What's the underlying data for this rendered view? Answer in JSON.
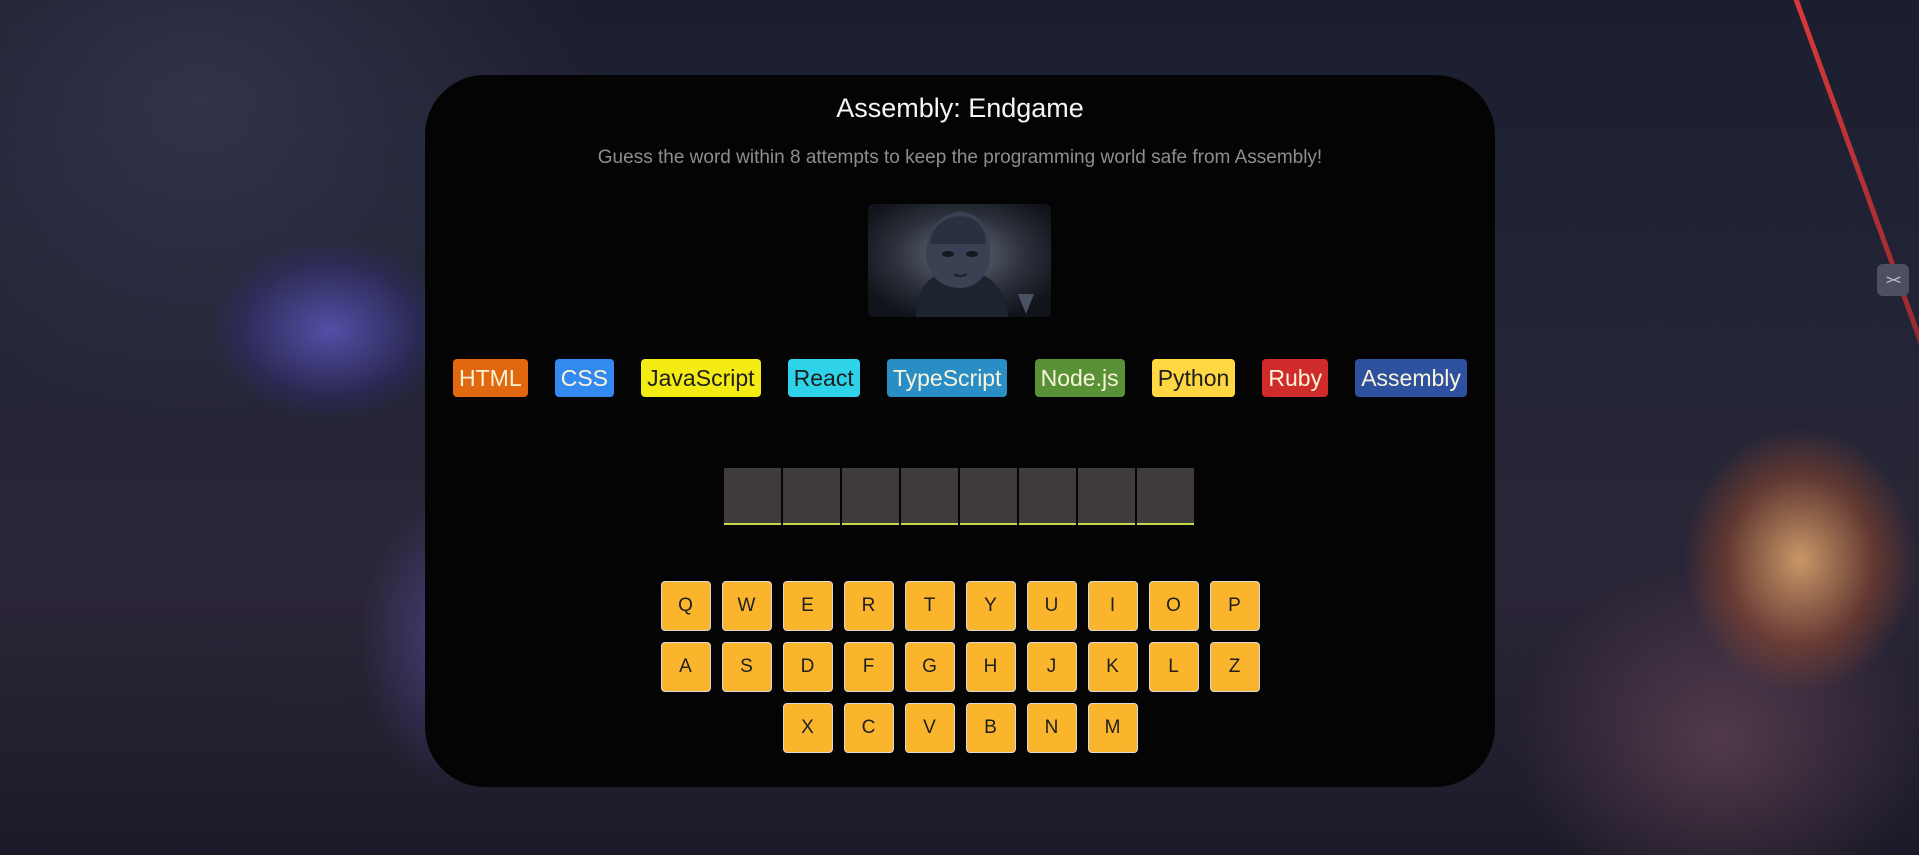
{
  "title": "Assembly: Endgame",
  "subtitle": "Guess the word within 8 attempts to keep the programming world safe from Assembly!",
  "side_button_icon": "collapse-arrows-icon",
  "side_button_glyph": "><",
  "languages": [
    {
      "name": "HTML",
      "bg": "#E2680F",
      "color": "#F9F4DA"
    },
    {
      "name": "CSS",
      "bg": "#328AF1",
      "color": "#F9F4DA"
    },
    {
      "name": "JavaScript",
      "bg": "#F4EB13",
      "color": "#1E1E1E"
    },
    {
      "name": "React",
      "bg": "#2ED3E9",
      "color": "#1E1E1E"
    },
    {
      "name": "TypeScript",
      "bg": "#298EC6",
      "color": "#F9F4DA"
    },
    {
      "name": "Node.js",
      "bg": "#599137",
      "color": "#F9F4DA"
    },
    {
      "name": "Python",
      "bg": "#FFD742",
      "color": "#1E1E1E"
    },
    {
      "name": "Ruby",
      "bg": "#D02B2B",
      "color": "#F9F4DA"
    },
    {
      "name": "Assembly",
      "bg": "#2D519F",
      "color": "#F9F4DA"
    }
  ],
  "word": {
    "length": 8,
    "letters": [
      "",
      "",
      "",
      "",
      "",
      "",
      "",
      ""
    ]
  },
  "keyboard": {
    "row1": [
      "Q",
      "W",
      "E",
      "R",
      "T",
      "Y",
      "U",
      "I",
      "O",
      "P"
    ],
    "row2": [
      "A",
      "S",
      "D",
      "F",
      "G",
      "H",
      "J",
      "K",
      "L",
      "Z"
    ],
    "row3": [
      "X",
      "C",
      "V",
      "B",
      "N",
      "M"
    ]
  },
  "colors": {
    "panel_bg": "#040404",
    "key_bg": "#FBB52C",
    "slot_bg": "#3F3B3A",
    "slot_underline": "#C8D64A"
  }
}
